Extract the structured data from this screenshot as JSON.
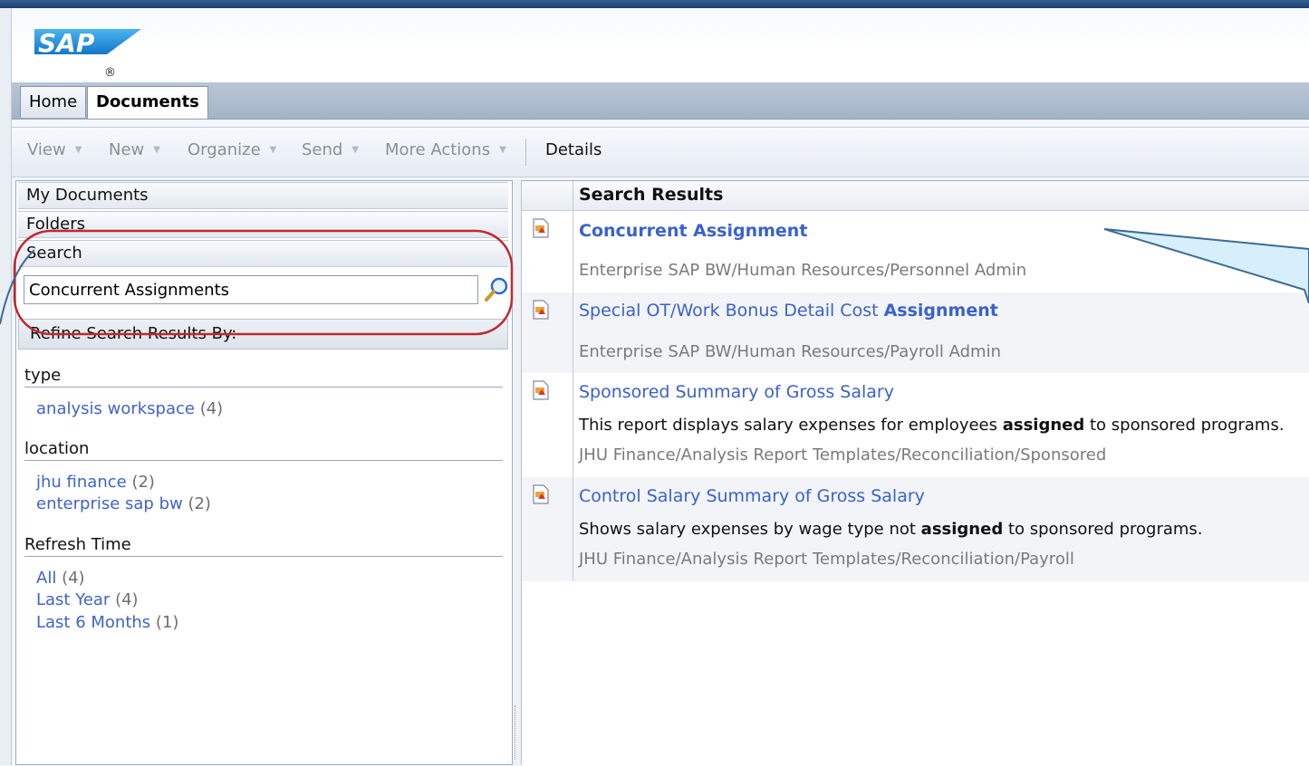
{
  "brand": {
    "logo_text": "SAP",
    "registered": "®"
  },
  "tabs": [
    {
      "label": "Home",
      "active": false
    },
    {
      "label": "Documents",
      "active": true
    }
  ],
  "toolbar": {
    "view": "View",
    "new": "New",
    "organize": "Organize",
    "send": "Send",
    "more_actions": "More Actions",
    "details": "Details"
  },
  "left_panel": {
    "my_documents": "My Documents",
    "folders": "Folders",
    "search": "Search",
    "search_value": "Concurrent Assignments",
    "refine_label": "Refine Search Results By:",
    "facets": [
      {
        "heading": "type",
        "items": [
          {
            "label": "analysis workspace",
            "count": "(4)"
          }
        ]
      },
      {
        "heading": "location",
        "items": [
          {
            "label": "jhu finance",
            "count": "(2)"
          },
          {
            "label": "enterprise sap bw",
            "count": "(2)"
          }
        ]
      },
      {
        "heading": "Refresh Time",
        "items": [
          {
            "label": "All",
            "count": "(4)"
          },
          {
            "label": "Last Year",
            "count": "(4)"
          },
          {
            "label": "Last 6 Months",
            "count": "(1)"
          }
        ]
      }
    ]
  },
  "results": {
    "header": "Search Results",
    "items": [
      {
        "title_pre": "",
        "title_bold": "Concurrent Assignment",
        "description_pre": "",
        "description_bold": "",
        "description_post": "",
        "path": "Enterprise SAP BW/Human Resources/Personnel Admin"
      },
      {
        "title_pre": "Special OT/Work Bonus Detail Cost ",
        "title_bold": "Assignment",
        "description_pre": "",
        "description_bold": "",
        "description_post": "",
        "path": "Enterprise SAP BW/Human Resources/Payroll Admin"
      },
      {
        "title_pre": "Sponsored Summary of Gross Salary",
        "title_bold": "",
        "description_pre": "This report displays salary expenses for employees ",
        "description_bold": "assigned",
        "description_post": " to sponsored programs.",
        "path": "JHU Finance/Analysis Report Templates/Reconciliation/Sponsored"
      },
      {
        "title_pre": "Control Salary Summary of Gross Salary",
        "title_bold": "",
        "description_pre": "Shows salary expenses by wage type not ",
        "description_bold": "assigned",
        "description_post": " to sponsored programs.",
        "path": "JHU Finance/Analysis Report Templates/Reconciliation/Payroll"
      }
    ]
  },
  "colors": {
    "link": "#3a62cc",
    "highlight_ring": "#c0282e",
    "callout_fill": "#d6effb",
    "callout_stroke": "#3d6a94"
  },
  "icons": {
    "search": "magnifier-icon",
    "document": "document-icon",
    "dropdown": "chevron-down-icon"
  }
}
